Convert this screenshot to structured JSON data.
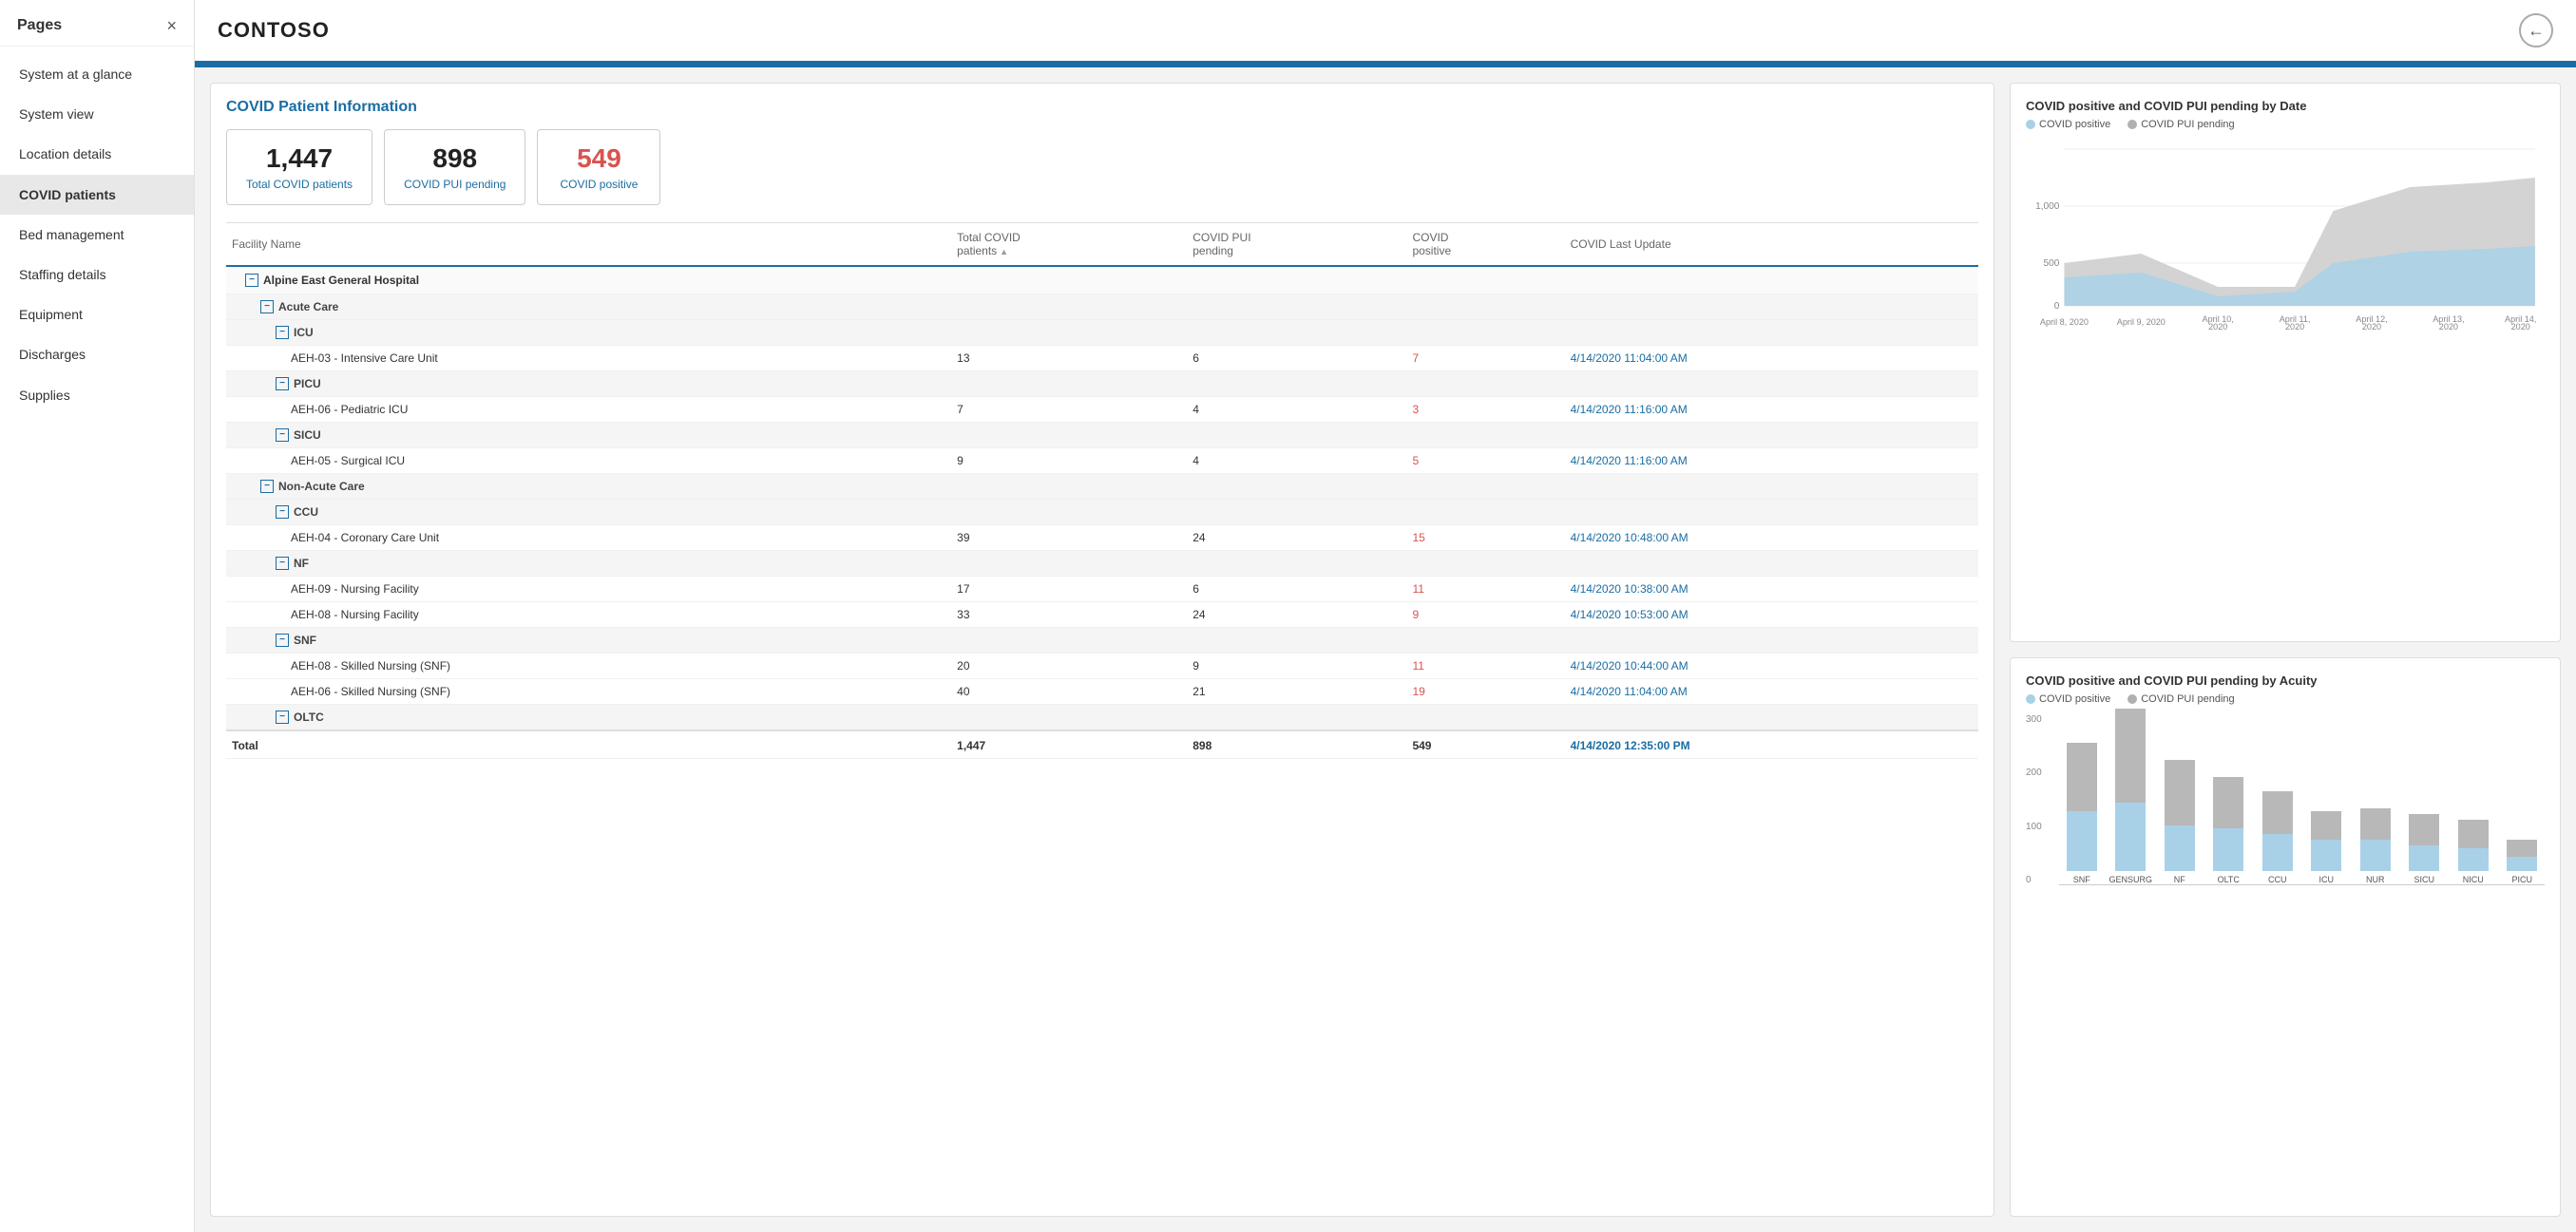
{
  "sidebar": {
    "title": "Pages",
    "close_label": "×",
    "items": [
      {
        "label": "System at a glance",
        "active": false
      },
      {
        "label": "System view",
        "active": false
      },
      {
        "label": "Location details",
        "active": false
      },
      {
        "label": "COVID patients",
        "active": true
      },
      {
        "label": "Bed management",
        "active": false
      },
      {
        "label": "Staffing details",
        "active": false
      },
      {
        "label": "Equipment",
        "active": false
      },
      {
        "label": "Discharges",
        "active": false
      },
      {
        "label": "Supplies",
        "active": false
      }
    ]
  },
  "topbar": {
    "title": "CONTOSO",
    "back_icon": "←"
  },
  "left_panel": {
    "section_title": "COVID Patient Information",
    "stats": [
      {
        "number": "1,447",
        "label": "Total COVID patients",
        "red": false
      },
      {
        "number": "898",
        "label": "COVID PUI pending",
        "red": false
      },
      {
        "number": "549",
        "label": "COVID positive",
        "red": true
      }
    ],
    "table": {
      "columns": [
        {
          "label": "Facility Name"
        },
        {
          "label": "Total COVID patients"
        },
        {
          "label": "COVID PUI pending"
        },
        {
          "label": "COVID positive"
        },
        {
          "label": "COVID Last Update"
        }
      ],
      "rows": [
        {
          "type": "group",
          "indent": 1,
          "name": "Alpine East General Hospital",
          "total": "",
          "pui": "",
          "positive": "",
          "update": ""
        },
        {
          "type": "subgroup",
          "indent": 2,
          "name": "Acute Care",
          "total": "",
          "pui": "",
          "positive": "",
          "update": ""
        },
        {
          "type": "subgroup2",
          "indent": 3,
          "name": "ICU",
          "total": "",
          "pui": "",
          "positive": "",
          "update": ""
        },
        {
          "type": "data",
          "indent": 4,
          "name": "AEH-03 - Intensive Care Unit",
          "total": "13",
          "pui": "6",
          "positive": "7",
          "update": "4/14/2020 11:04:00 AM"
        },
        {
          "type": "subgroup2",
          "indent": 3,
          "name": "PICU",
          "total": "",
          "pui": "",
          "positive": "",
          "update": ""
        },
        {
          "type": "data",
          "indent": 4,
          "name": "AEH-06 - Pediatric ICU",
          "total": "7",
          "pui": "4",
          "positive": "3",
          "update": "4/14/2020 11:16:00 AM"
        },
        {
          "type": "subgroup2",
          "indent": 3,
          "name": "SICU",
          "total": "",
          "pui": "",
          "positive": "",
          "update": ""
        },
        {
          "type": "data",
          "indent": 4,
          "name": "AEH-05 - Surgical ICU",
          "total": "9",
          "pui": "4",
          "positive": "5",
          "update": "4/14/2020 11:16:00 AM"
        },
        {
          "type": "subgroup",
          "indent": 2,
          "name": "Non-Acute Care",
          "total": "",
          "pui": "",
          "positive": "",
          "update": ""
        },
        {
          "type": "subgroup2",
          "indent": 3,
          "name": "CCU",
          "total": "",
          "pui": "",
          "positive": "",
          "update": ""
        },
        {
          "type": "data",
          "indent": 4,
          "name": "AEH-04 - Coronary Care Unit",
          "total": "39",
          "pui": "24",
          "positive": "15",
          "update": "4/14/2020 10:48:00 AM"
        },
        {
          "type": "subgroup2",
          "indent": 3,
          "name": "NF",
          "total": "",
          "pui": "",
          "positive": "",
          "update": ""
        },
        {
          "type": "data",
          "indent": 4,
          "name": "AEH-09 - Nursing Facility",
          "total": "17",
          "pui": "6",
          "positive": "11",
          "update": "4/14/2020 10:38:00 AM"
        },
        {
          "type": "data",
          "indent": 4,
          "name": "AEH-08 - Nursing Facility",
          "total": "33",
          "pui": "24",
          "positive": "9",
          "update": "4/14/2020 10:53:00 AM"
        },
        {
          "type": "subgroup2",
          "indent": 3,
          "name": "SNF",
          "total": "",
          "pui": "",
          "positive": "",
          "update": ""
        },
        {
          "type": "data",
          "indent": 4,
          "name": "AEH-08 - Skilled Nursing (SNF)",
          "total": "20",
          "pui": "9",
          "positive": "11",
          "update": "4/14/2020 10:44:00 AM"
        },
        {
          "type": "data",
          "indent": 4,
          "name": "AEH-06 - Skilled Nursing (SNF)",
          "total": "40",
          "pui": "21",
          "positive": "19",
          "update": "4/14/2020 11:04:00 AM"
        },
        {
          "type": "subgroup2",
          "indent": 3,
          "name": "OLTC",
          "total": "",
          "pui": "",
          "positive": "",
          "update": ""
        }
      ],
      "total_row": {
        "label": "Total",
        "total": "1,447",
        "pui": "898",
        "positive": "549",
        "update": "4/14/2020 12:35:00 PM"
      }
    }
  },
  "right_panel": {
    "area_chart": {
      "title": "COVID positive and COVID PUI pending by Date",
      "legend": [
        {
          "label": "COVID positive",
          "color": "#a8d1e8"
        },
        {
          "label": "COVID PUI pending",
          "color": "#b0b0b0"
        }
      ],
      "y_labels": [
        "1,000",
        "500",
        "0"
      ],
      "x_labels": [
        "April 8, 2020",
        "April 9, 2020",
        "April 10,\n2020",
        "April 11,\n2020",
        "April 12,\n2020",
        "April 13,\n2020",
        "April 14,\n2020"
      ]
    },
    "bar_chart": {
      "title": "COVID positive and COVID PUI pending by Acuity",
      "legend": [
        {
          "label": "COVID positive",
          "color": "#a8d1e8"
        },
        {
          "label": "COVID PUI pending",
          "color": "#b0b0b0"
        }
      ],
      "y_labels": [
        "300",
        "200",
        "100",
        "0"
      ],
      "bars": [
        {
          "label": "SNF",
          "positive": 105,
          "pui": 120
        },
        {
          "label": "GENSURG",
          "positive": 120,
          "pui": 165
        },
        {
          "label": "NF",
          "positive": 80,
          "pui": 115
        },
        {
          "label": "OLTC",
          "positive": 75,
          "pui": 90
        },
        {
          "label": "CCU",
          "positive": 65,
          "pui": 75
        },
        {
          "label": "ICU",
          "positive": 55,
          "pui": 50
        },
        {
          "label": "NUR",
          "positive": 55,
          "pui": 55
        },
        {
          "label": "SICU",
          "positive": 45,
          "pui": 55
        },
        {
          "label": "NICU",
          "positive": 40,
          "pui": 50
        },
        {
          "label": "PICU",
          "positive": 25,
          "pui": 30
        }
      ]
    }
  },
  "colors": {
    "accent": "#1a6da3",
    "positive": "#a8d1e8",
    "pui": "#b8b8b8",
    "red": "#d9534f"
  }
}
